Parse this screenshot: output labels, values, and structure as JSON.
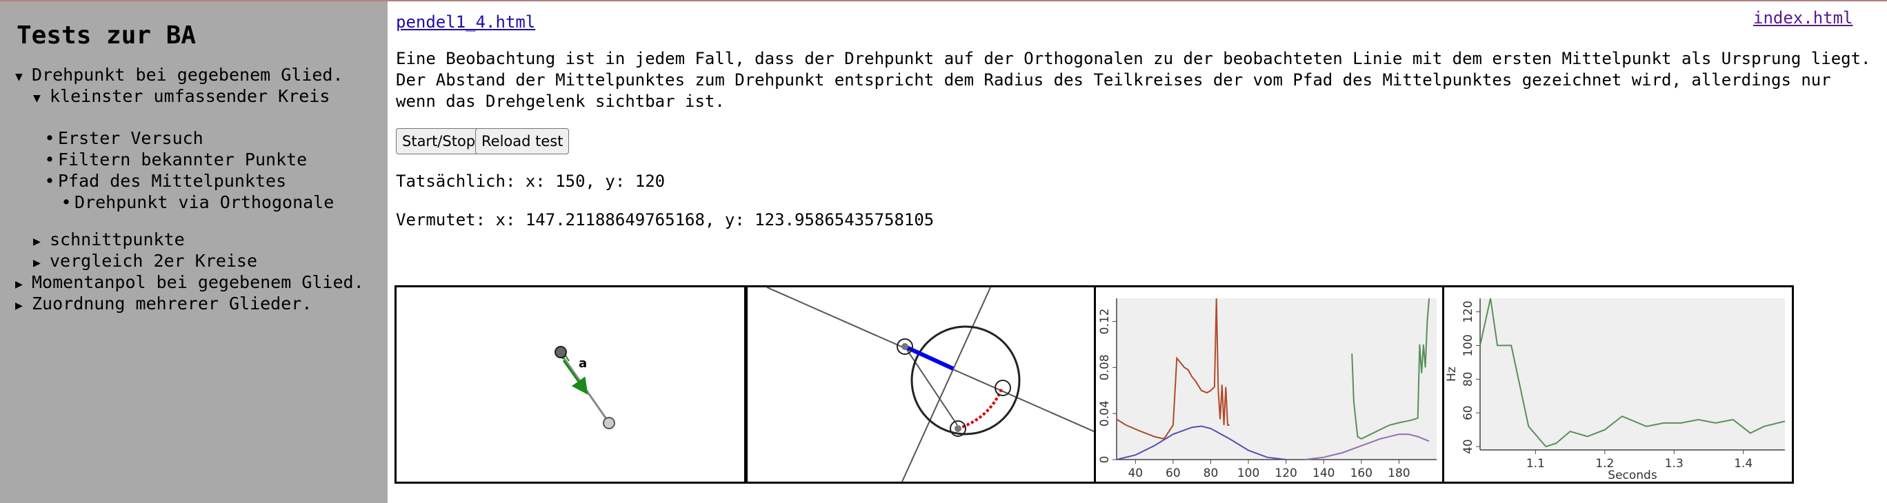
{
  "sidebar": {
    "title": "Tests zur BA",
    "items": [
      {
        "label": "Drehpunkt bei gegebenem Glied.",
        "marker": "▼"
      },
      {
        "label": "kleinster umfassender Kreis",
        "marker": "▼"
      },
      {
        "label": "Erster Versuch",
        "marker": "•"
      },
      {
        "label": "Filtern bekannter Punkte",
        "marker": "•"
      },
      {
        "label": "Pfad des Mittelpunktes",
        "marker": "•"
      },
      {
        "label": "Drehpunkt via Orthogonale",
        "marker": "•"
      },
      {
        "label": "schnittpunkte",
        "marker": "▶"
      },
      {
        "label": "vergleich 2er Kreise",
        "marker": "▶"
      },
      {
        "label": "Momentanpol bei gegebenem Glied.",
        "marker": "▶"
      },
      {
        "label": "Zuordnung mehrerer Glieder.",
        "marker": "▶"
      }
    ]
  },
  "main": {
    "file_link": "pendel1_4.html",
    "index_link": "index.html",
    "description": "Eine Beobachtung ist in jedem Fall, dass der Drehpunkt auf der Orthogonalen zu der beobachteten Linie mit dem ersten Mittelpunkt als Ursprung liegt. Der Abstand der Mittelpunktes zum Drehpunkt entspricht dem Radius des Teilkreises der vom Pfad des Mittelpunktes gezeichnet wird, allerdings nur wenn das Drehgelenk sichtbar ist.",
    "buttons": {
      "start_stop": "Start/Stop",
      "reload": "Reload test"
    },
    "actual": "Tatsächlich: x: 150, y: 120",
    "guessed": "Vermutet: x: 147.21188649765168, y: 123.95865435758105"
  },
  "panels": {
    "pendulum_label": "a",
    "colors": {
      "link_arrow": "#1a8a1a",
      "orthogonal": "#0000ee",
      "path": "#dd0000",
      "red_series": "#b04a2a",
      "green_series": "#5a8f5a",
      "blue_series": "#5050b0",
      "purple_series": "#9070b0"
    }
  },
  "chart_data": [
    {
      "type": "line",
      "x_ticks": [
        "40",
        "60",
        "80",
        "100",
        "120",
        "140",
        "160",
        "180"
      ],
      "y_ticks": [
        "0",
        "0.04",
        "0.08",
        "0.12"
      ],
      "xlim": [
        30,
        200
      ],
      "ylim": [
        0,
        0.14
      ],
      "series": [
        {
          "color": "#b04a2a",
          "x": [
            30,
            35,
            42,
            50,
            55,
            56,
            60,
            62,
            66,
            68,
            70,
            72,
            75,
            78,
            80,
            82,
            83,
            84,
            85,
            86,
            87,
            88,
            89,
            90
          ],
          "y": [
            0.035,
            0.03,
            0.025,
            0.02,
            0.018,
            0.02,
            0.03,
            0.088,
            0.08,
            0.078,
            0.072,
            0.068,
            0.06,
            0.058,
            0.06,
            0.063,
            0.14,
            0.06,
            0.035,
            0.065,
            0.03,
            0.063,
            0.03,
            0.03
          ]
        },
        {
          "color": "#5a8f5a",
          "x": [
            155,
            156,
            158,
            160,
            165,
            170,
            175,
            180,
            183,
            186,
            190,
            191,
            192,
            193,
            194,
            195,
            196
          ],
          "y": [
            0.092,
            0.05,
            0.02,
            0.018,
            0.022,
            0.026,
            0.03,
            0.032,
            0.033,
            0.034,
            0.036,
            0.1,
            0.075,
            0.1,
            0.08,
            0.12,
            0.14
          ]
        },
        {
          "color": "#5050b0",
          "x": [
            30,
            40,
            50,
            60,
            70,
            75,
            80,
            90,
            100,
            110,
            120
          ],
          "y": [
            0,
            0.004,
            0.012,
            0.022,
            0.028,
            0.029,
            0.027,
            0.018,
            0.008,
            0.002,
            0
          ]
        },
        {
          "color": "#9070b0",
          "x": [
            130,
            140,
            150,
            160,
            170,
            180,
            185,
            190,
            196
          ],
          "y": [
            0,
            0.002,
            0.006,
            0.012,
            0.018,
            0.022,
            0.022,
            0.02,
            0.016
          ]
        }
      ]
    },
    {
      "type": "line",
      "xlabel": "Seconds",
      "ylabel": "Hz",
      "x_ticks": [
        "1.1",
        "1.2",
        "1.3",
        "1.4"
      ],
      "y_ticks": [
        "40",
        "60",
        "80",
        "100",
        "120"
      ],
      "xlim": [
        1.02,
        1.46
      ],
      "ylim": [
        38,
        128
      ],
      "series": [
        {
          "color": "#5a8f5a",
          "x": [
            1.02,
            1.035,
            1.045,
            1.065,
            1.09,
            1.115,
            1.13,
            1.15,
            1.175,
            1.2,
            1.225,
            1.26,
            1.285,
            1.31,
            1.335,
            1.36,
            1.385,
            1.41,
            1.43,
            1.46
          ],
          "y": [
            100,
            128,
            100,
            100,
            52,
            40,
            42,
            49,
            46,
            50,
            58,
            52,
            54,
            54,
            56,
            54,
            56,
            48,
            52,
            55
          ]
        }
      ]
    }
  ]
}
